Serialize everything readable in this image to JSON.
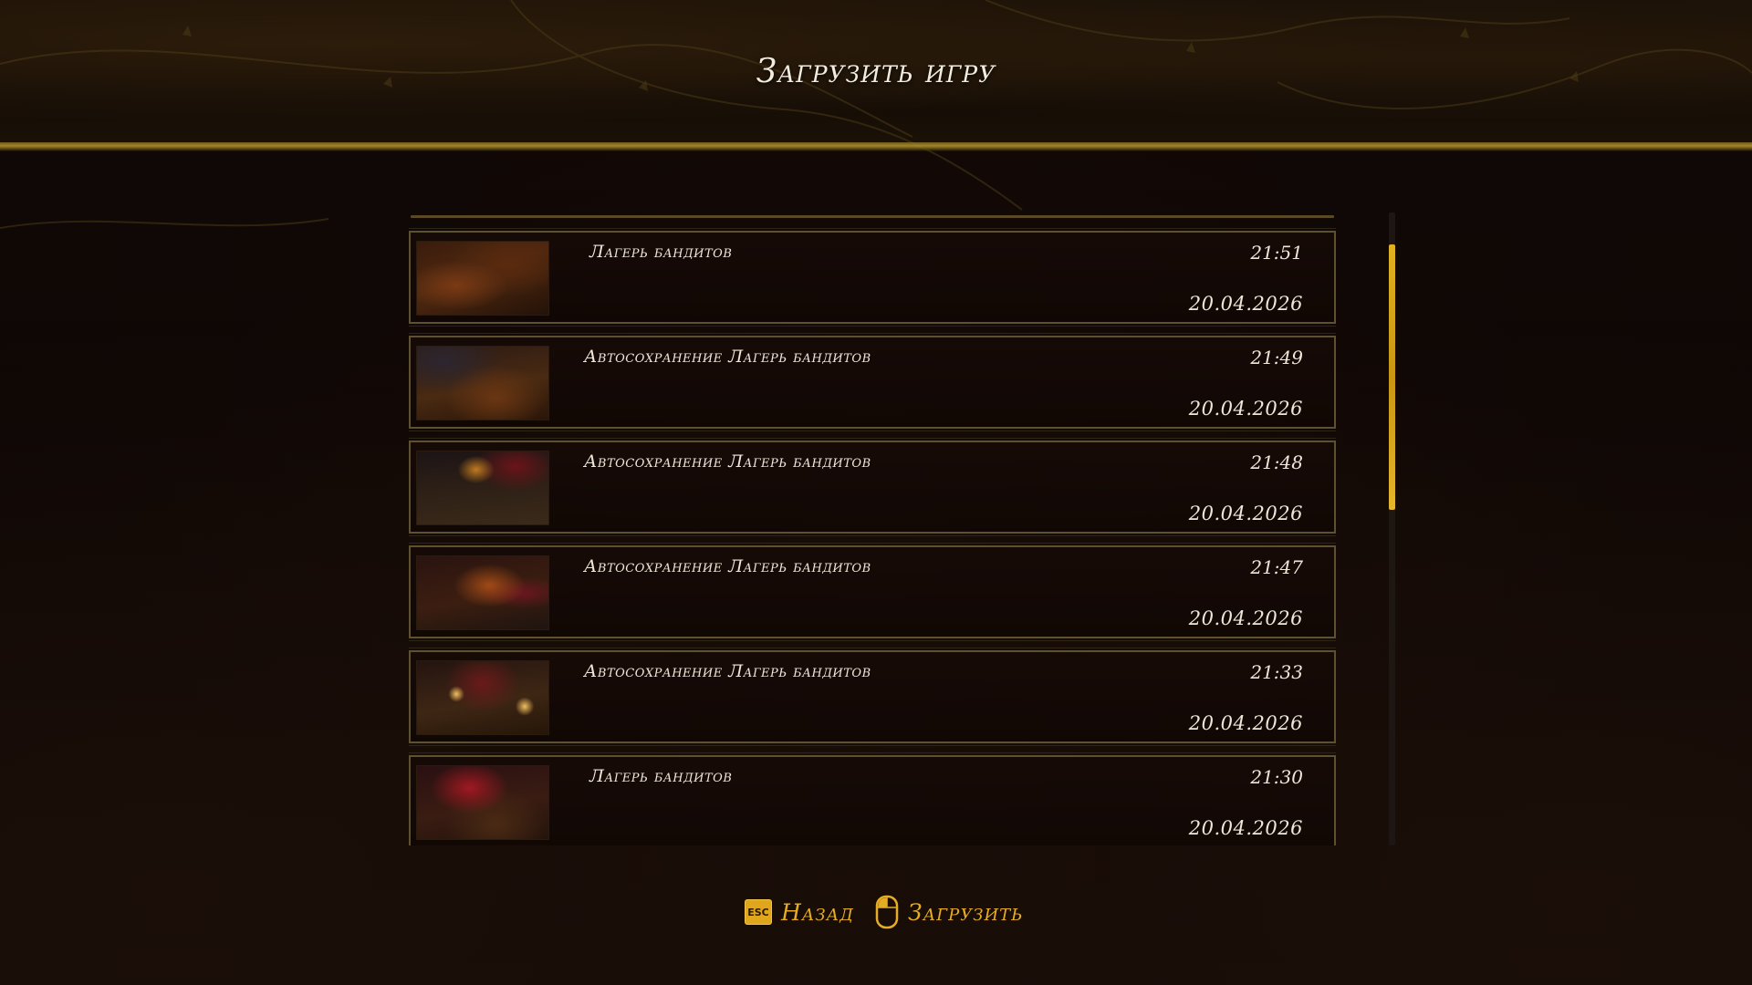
{
  "header": {
    "title": "Загрузить игру"
  },
  "saves": [
    {
      "name": "Лагерь бандитов",
      "time": "21:51",
      "date": "20.04.2026",
      "thumbnail": "campfire-clearing-thumbnail"
    },
    {
      "name": "Автосохранение Лагерь бандитов",
      "time": "21:49",
      "date": "20.04.2026",
      "thumbnail": "forest-path-thumbnail"
    },
    {
      "name": "Автосохранение Лагерь бандитов",
      "time": "21:48",
      "date": "20.04.2026",
      "thumbnail": "dark-camp-thumbnail"
    },
    {
      "name": "Автосохранение Лагерь бандитов",
      "time": "21:47",
      "date": "20.04.2026",
      "thumbnail": "bonfire-camp-thumbnail"
    },
    {
      "name": "Автосохранение Лагерь бандитов",
      "time": "21:33",
      "date": "20.04.2026",
      "thumbnail": "lanterns-camp-thumbnail"
    },
    {
      "name": "Лагерь бандитов",
      "time": "21:30",
      "date": "20.04.2026",
      "thumbnail": "red-banner-camp-thumbnail"
    }
  ],
  "scrollbar": {
    "position_fraction": 0.05,
    "visible_fraction": 0.42,
    "color": "#d9a81a"
  },
  "footer": {
    "back_key": "ESC",
    "back_label": "Назад",
    "load_icon": "mouse-left-click-icon",
    "load_label": "Загрузить"
  },
  "colors": {
    "accent": "#e6ad24",
    "text": "#efe8da",
    "frame": "#5d5130",
    "background": "#120906"
  }
}
